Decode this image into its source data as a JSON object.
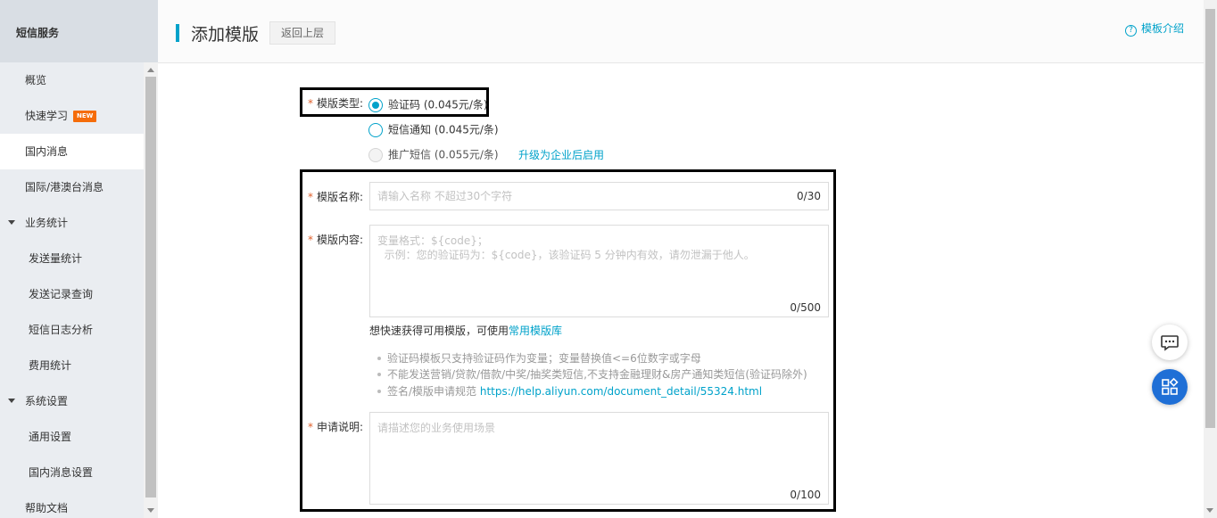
{
  "sidebar": {
    "header": "短信服务",
    "items": [
      {
        "label": "概览"
      },
      {
        "label": "快速学习",
        "badge": "NEW"
      },
      {
        "label": "国内消息"
      },
      {
        "label": "国际/港澳台消息"
      },
      {
        "label": "业务统计"
      },
      {
        "label": "发送量统计"
      },
      {
        "label": "发送记录查询"
      },
      {
        "label": "短信日志分析"
      },
      {
        "label": "费用统计"
      },
      {
        "label": "系统设置"
      },
      {
        "label": "通用设置"
      },
      {
        "label": "国内消息设置"
      },
      {
        "label": "帮助文档"
      }
    ],
    "active": "国内消息"
  },
  "header": {
    "title": "添加模版",
    "back_label": "返回上层",
    "intro_link": "模板介绍",
    "intro_icon": "?"
  },
  "form": {
    "type": {
      "label": "模版类型:",
      "options": [
        {
          "label": "验证码 (0.045元/条)",
          "checked": true
        },
        {
          "label": "短信通知 (0.045元/条)",
          "checked": false
        },
        {
          "label": "推广短信 (0.055元/条)",
          "checked": false,
          "disabled": true
        }
      ],
      "upgrade_link": "升级为企业后启用"
    },
    "name": {
      "label": "模版名称:",
      "placeholder": "请输入名称 不超过30个字符",
      "counter": "0/30"
    },
    "content": {
      "label": "模版内容:",
      "placeholder_line1": "变量格式：${code}；",
      "placeholder_line2": "  示例：您的验证码为：${code}，该验证码 5 分钟内有效，请勿泄漏于他人。",
      "counter": "0/500",
      "hint_prefix": "想快速获得可用模版，可使用",
      "hint_link": "常用模版库",
      "tips": [
        "验证码模板只支持验证码作为变量；变量替换值<=6位数字或字母",
        "不能发送营销/贷款/借款/中奖/抽奖类短信,不支持金融理财&房产通知类短信(验证码除外)"
      ],
      "tip3_prefix": "签名/模版申请规范 ",
      "tip3_link": "https://help.aliyun.com/document_detail/55324.html"
    },
    "remark": {
      "label": "申请说明:",
      "placeholder": "请描述您的业务使用场景",
      "counter": "0/100"
    },
    "required_mark": "*"
  },
  "floating": {
    "chat_icon": "chat-bubble-icon",
    "apps_icon": "apps-grid-icon"
  },
  "colors": {
    "accent": "#00a2ca",
    "required": "#e0602c",
    "badge": "#f56c0a",
    "apps_button": "#1f6fd6"
  }
}
